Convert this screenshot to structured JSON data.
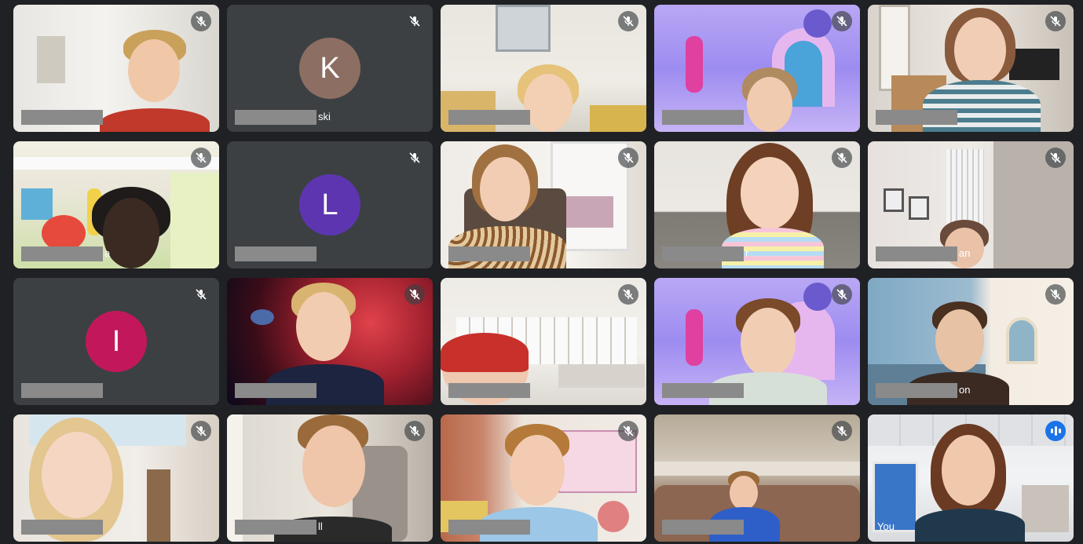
{
  "meeting": {
    "colors": {
      "background": "#202124",
      "tile": "#3c4043",
      "active_outline": "#8ab4f8",
      "speaking": "#1a73e8",
      "redaction": "#8a8a8a"
    },
    "tiles": [
      {
        "type": "video",
        "name_suffix": "",
        "muted": true
      },
      {
        "type": "avatar",
        "initial": "K",
        "avatar_color": "#8d6e63",
        "name_suffix": "ski",
        "muted": true
      },
      {
        "type": "video",
        "name_suffix": "",
        "muted": true
      },
      {
        "type": "video",
        "name_suffix": "",
        "muted": true
      },
      {
        "type": "video",
        "name_suffix": "",
        "muted": true
      },
      {
        "type": "video",
        "name_suffix": "a",
        "muted": true
      },
      {
        "type": "avatar",
        "initial": "L",
        "avatar_color": "#5e35b1",
        "name_suffix": "",
        "muted": true
      },
      {
        "type": "video",
        "name_suffix": "",
        "muted": true
      },
      {
        "type": "video",
        "name_suffix": "r",
        "muted": true
      },
      {
        "type": "video",
        "name_suffix": "an",
        "muted": true
      },
      {
        "type": "avatar",
        "initial": "I",
        "avatar_color": "#c2185b",
        "name_suffix": "",
        "muted": true
      },
      {
        "type": "video",
        "name_suffix": "",
        "muted": true
      },
      {
        "type": "video",
        "name_suffix": "",
        "muted": true
      },
      {
        "type": "video",
        "name_suffix": "",
        "muted": true
      },
      {
        "type": "video",
        "name_suffix": "on",
        "muted": true
      },
      {
        "type": "video",
        "name_suffix": "",
        "muted": true
      },
      {
        "type": "video",
        "name_suffix": "ll",
        "muted": true
      },
      {
        "type": "video",
        "name_suffix": "",
        "muted": true
      },
      {
        "type": "video",
        "name_suffix": "",
        "muted": true
      },
      {
        "type": "video",
        "name_suffix": "You",
        "muted": false,
        "speaking": true
      }
    ]
  }
}
